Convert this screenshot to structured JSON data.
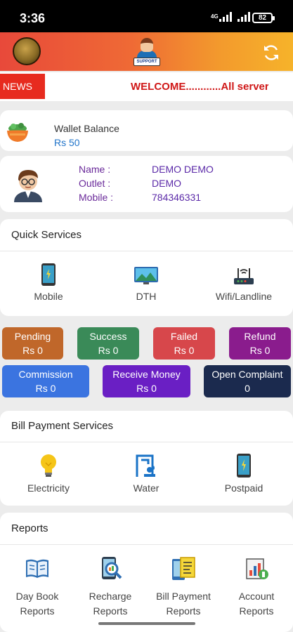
{
  "status_bar": {
    "time": "3:36",
    "network": "4G",
    "battery": "82"
  },
  "app_bar": {
    "support_label": "SUPPORT"
  },
  "news": {
    "label": "NEWS",
    "ticker": "WELCOME............All server"
  },
  "wallet": {
    "title": "Wallet Balance",
    "amount": "Rs 50"
  },
  "profile": {
    "name_label": "Name :",
    "name": "DEMO DEMO",
    "outlet_label": "Outlet :",
    "outlet": "DEMO",
    "mobile_label": "Mobile :",
    "mobile": "784346331"
  },
  "quick_services": {
    "title": "Quick Services",
    "items": [
      {
        "label": "Mobile",
        "icon": "mobile-icon"
      },
      {
        "label": "DTH",
        "icon": "dth-icon"
      },
      {
        "label": "Wifi/Landline",
        "icon": "router-icon"
      }
    ]
  },
  "stats": [
    {
      "label": "Pending",
      "value": "Rs 0",
      "color": "#c0672a"
    },
    {
      "label": "Success",
      "value": "Rs 0",
      "color": "#3a8a58"
    },
    {
      "label": "Failed",
      "value": "Rs 0",
      "color": "#d7474b"
    },
    {
      "label": "Refund",
      "value": "Rs 0",
      "color": "#8a1c8d"
    },
    {
      "label": "Commission",
      "value": "Rs 0",
      "color": "#3b74e0"
    },
    {
      "label": "Receive Money",
      "value": "Rs 0",
      "color": "#6a1fc4"
    },
    {
      "label": "Open Complaint",
      "value": "0",
      "color": "#1b2a4e"
    }
  ],
  "bill_payment": {
    "title": "Bill Payment Services",
    "items": [
      {
        "label": "Electricity",
        "icon": "bulb-icon"
      },
      {
        "label": "Water",
        "icon": "water-icon"
      },
      {
        "label": "Postpaid",
        "icon": "phone-icon"
      }
    ]
  },
  "reports": {
    "title": "Reports",
    "items": [
      {
        "line1": "Day Book",
        "line2": "Reports",
        "icon": "book-icon"
      },
      {
        "line1": "Recharge",
        "line2": "Reports",
        "icon": "recharge-report-icon"
      },
      {
        "line1": "Bill Payment",
        "line2": "Reports",
        "icon": "bill-report-icon"
      },
      {
        "line1": "Account",
        "line2": "Reports",
        "icon": "account-report-icon"
      }
    ]
  }
}
